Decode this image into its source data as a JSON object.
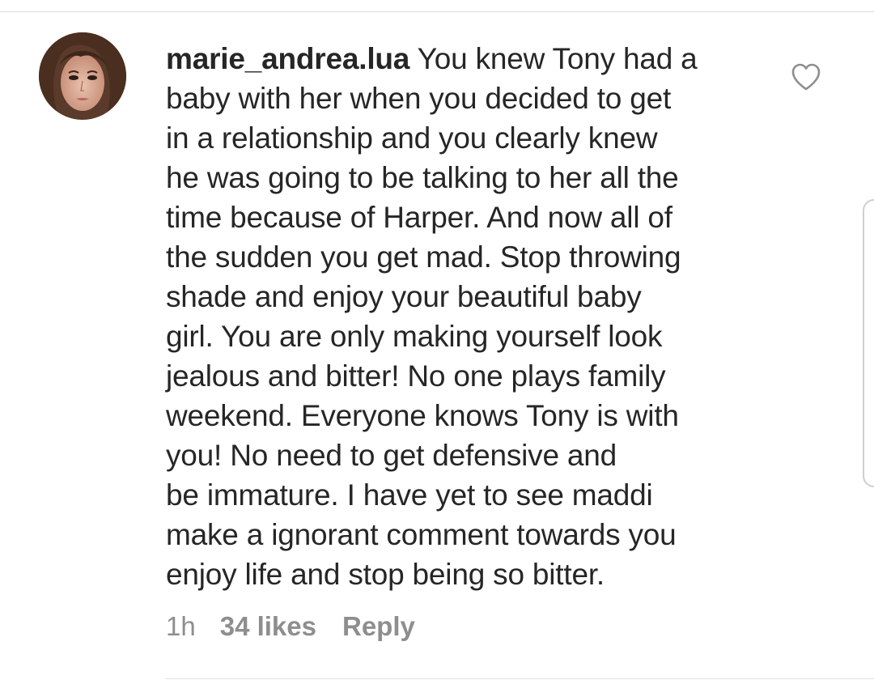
{
  "comment": {
    "username": "marie_andrea.lua",
    "text": "You knew Tony had a\nbaby with her when you decided to get\nin a relationship and you clearly knew\nhe was going to be talking to her all the\ntime because of Harper. And now all of\nthe sudden you get mad. Stop throwing\nshade and enjoy your beautiful baby\ngirl. You are only making yourself look\njealous and bitter! No one plays family\nweekend. Everyone knows Tony is with\nyou! No need to get defensive and\nbe immature. I have yet to see maddi\nmake a ignorant comment towards you\nenjoy life and stop being so bitter.",
    "time": "1h",
    "likes": "34 likes",
    "reply": "Reply"
  },
  "icons": {
    "like": "heart-outline-icon",
    "avatar": "profile-photo"
  },
  "colors": {
    "text": "#262626",
    "meta": "#8e8e8e",
    "divider": "#e0e0e0"
  }
}
